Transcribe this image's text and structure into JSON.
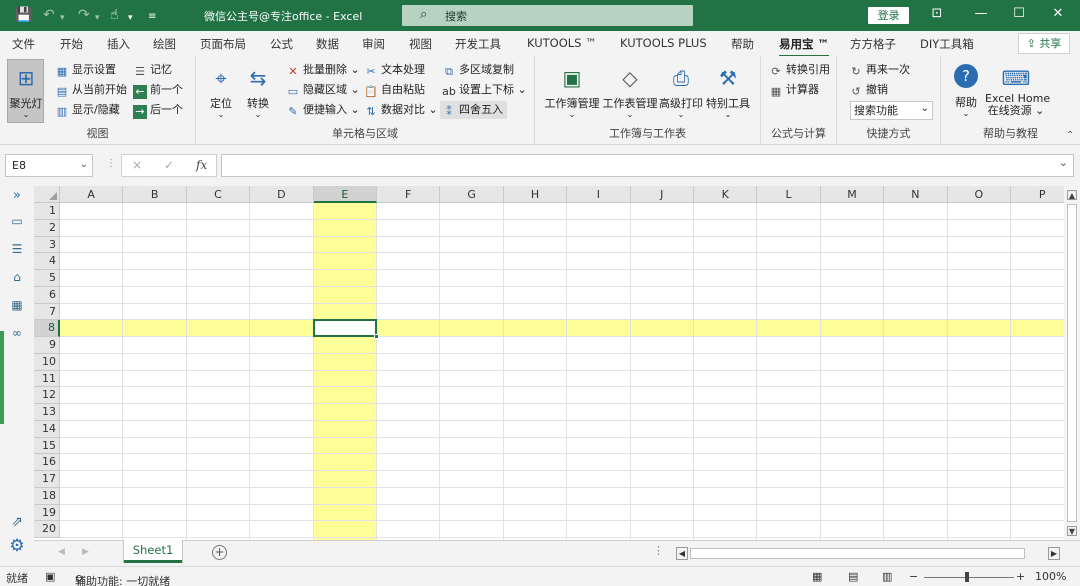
{
  "title_bar": {
    "window_title": "微信公主号@专注office  -  Excel",
    "search_placeholder": "搜索",
    "login_label": "登录"
  },
  "ribbon_tabs": [
    "文件",
    "开始",
    "插入",
    "绘图",
    "页面布局",
    "公式",
    "数据",
    "审阅",
    "视图",
    "开发工具",
    "KUTOOLS ™",
    "KUTOOLS PLUS",
    "帮助",
    "易用宝 ™",
    "方方格子",
    "DIY工具箱"
  ],
  "active_tab": "易用宝 ™",
  "share_label": "共享",
  "groups": {
    "view": {
      "label": "视图",
      "spotlight": "聚光灯",
      "items": [
        "显示设置",
        "从当前开始",
        "显示/隐藏"
      ],
      "items2": [
        "记忆",
        "前一个",
        "后一个"
      ]
    },
    "cells": {
      "label": "单元格与区域",
      "locate": "定位",
      "convert": "转换",
      "col1": [
        "批量删除",
        "隐藏区域",
        "便捷输入"
      ],
      "col2": [
        "文本处理",
        "自由粘贴",
        "数据对比"
      ],
      "col3": [
        "多区域复制",
        "设置上下标",
        "四舍五入"
      ]
    },
    "workbook": {
      "label": "工作簿与工作表",
      "items": [
        "工作簿管理",
        "工作表管理",
        "高级打印",
        "特别工具"
      ]
    },
    "formula": {
      "label": "公式与计算",
      "items": [
        "转换引用",
        "计算器"
      ]
    },
    "shortcut": {
      "label": "快捷方式",
      "items": [
        "再来一次",
        "撤销"
      ],
      "combo": "搜索功能"
    },
    "help": {
      "label": "帮助与教程",
      "help": "帮助",
      "excelhome": "Excel Home",
      "online": "在线资源"
    }
  },
  "formula_bar": {
    "name_box": "E8",
    "fx": "fx",
    "cancel": "×",
    "enter": "✓",
    "value": ""
  },
  "columns": [
    "A",
    "B",
    "C",
    "D",
    "E",
    "F",
    "G",
    "H",
    "I",
    "J",
    "K",
    "L",
    "M",
    "N",
    "O",
    "P"
  ],
  "rows": [
    "1",
    "2",
    "3",
    "4",
    "5",
    "6",
    "7",
    "8",
    "9",
    "10",
    "11",
    "12",
    "13",
    "14",
    "15",
    "16",
    "17",
    "18",
    "19",
    "20"
  ],
  "selected_cell": {
    "column": "E",
    "row": "8"
  },
  "highlight_color": "#FFFF99",
  "accent_color": "#217346",
  "sheet": {
    "name": "Sheet1"
  },
  "status": {
    "ready": "就绪",
    "accessibility": "辅助功能: 一切就绪",
    "zoom": "100%"
  }
}
